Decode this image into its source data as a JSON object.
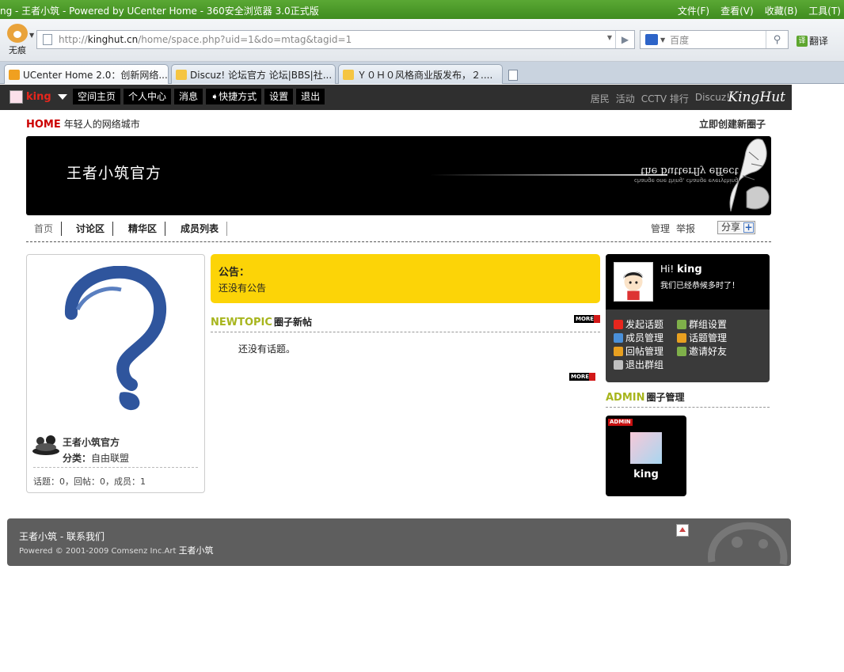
{
  "browser": {
    "window_title": "ng - 王者小筑 - Powered by UCenter Home - 360安全浏览器 3.0正式版",
    "menus": [
      "文件(F)",
      "查看(V)",
      "收藏(B)",
      "工具(T)"
    ],
    "incognito_label": "无痕",
    "url_prefix": "http://",
    "url_host": "kinghut.cn",
    "url_path": "/home/space.php?uid=1&do=mtag&tagid=1",
    "search_placeholder": "百度",
    "translate_label": "翻译",
    "tabs": [
      {
        "label": "UCenter Home 2.0：创新网络...",
        "icon_color": "#f0a020"
      },
      {
        "label": "Discuz! 论坛官方 论坛|BBS|社...",
        "icon_color": "#f5c542"
      },
      {
        "label": "Ｙ０Ｈ０风格商业版发布，２....",
        "icon_color": "#f5c542"
      }
    ]
  },
  "site": {
    "username": "king",
    "topnav": [
      "空间主页",
      "个人中心",
      "消息",
      "➧快捷方式",
      "设置",
      "退出"
    ],
    "toplinks": [
      "居民",
      "活动",
      "CCTV 排行",
      "Discuz!"
    ],
    "brand": "KingHut",
    "home_label": "HOME",
    "home_slogan": "年轻人的网络城市",
    "create_group": "立即创建新圈子"
  },
  "group": {
    "name": "王者小筑官方",
    "banner_motto": "the butterfly effect",
    "banner_motto_small": "change one thing, change everything",
    "tabs": [
      "首页",
      "讨论区",
      "精华区",
      "成员列表"
    ],
    "right_links": [
      "管理",
      "举报"
    ],
    "share_label": "分享",
    "card_name": "王者小筑官方",
    "category_label": "分类：",
    "category_value": "自由联盟",
    "stats": "话题：0，回帖：0，成员：1"
  },
  "notice": {
    "title": "公告：",
    "body": "还没有公告"
  },
  "topics": {
    "head_en": "NEWTOPIC",
    "head_cn": "圈子新帖",
    "more_label": "MORE",
    "empty": "还没有话题。"
  },
  "userpanel": {
    "hi": "Hi!",
    "name": "king",
    "welcome": "我们已经恭候多时了！",
    "actions": [
      {
        "label": "发起话题",
        "icon": "heart-icon",
        "color": "#e8261d"
      },
      {
        "label": "群组设置",
        "icon": "settings-icon",
        "color": "#7fb04a"
      },
      {
        "label": "成员管理",
        "icon": "members-icon",
        "color": "#4a90d9"
      },
      {
        "label": "话题管理",
        "icon": "topic-icon",
        "color": "#e8a020"
      },
      {
        "label": "回帖管理",
        "icon": "reply-icon",
        "color": "#e8a020"
      },
      {
        "label": "邀请好友",
        "icon": "invite-icon",
        "color": "#7fb04a"
      },
      {
        "label": "退出群组",
        "icon": "exit-icon",
        "color": "#c0c0c0"
      }
    ]
  },
  "admin": {
    "head_en": "ADMIN",
    "head_cn": "圈子管理",
    "badge": "ADMIN",
    "name": "king"
  },
  "footer": {
    "line1": "王者小筑 - 联系我们",
    "line2_prefix": "Powered © 2001-2009 Comsenz Inc.Art",
    "line2_site": "王者小筑"
  }
}
